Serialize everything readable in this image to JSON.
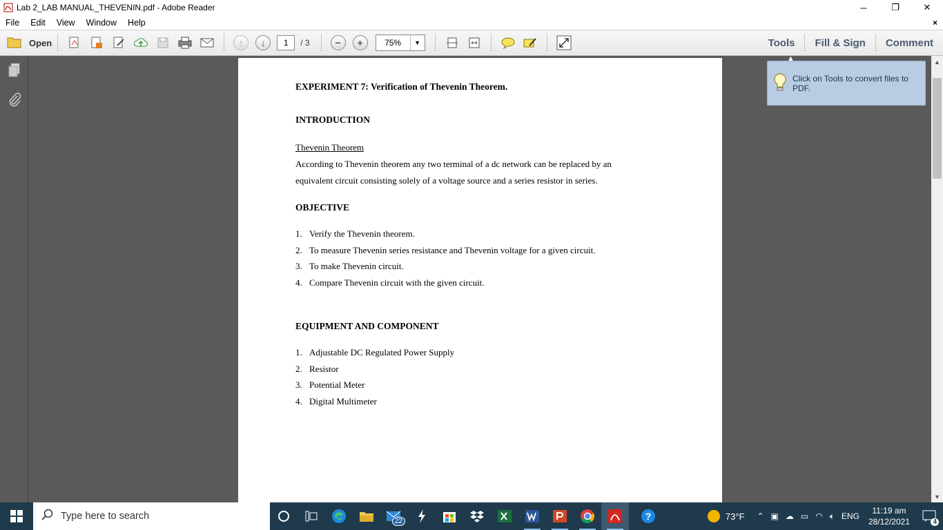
{
  "window": {
    "title": "Lab 2_LAB MANUAL_THEVENIN.pdf - Adobe Reader",
    "minimize": "─",
    "restore": "❐",
    "close": "✕"
  },
  "menu": {
    "items": [
      "File",
      "Edit",
      "View",
      "Window",
      "Help"
    ],
    "close_doc": "×"
  },
  "toolbar": {
    "open_label": "Open",
    "page_current": "1",
    "page_total": "/ 3",
    "zoom_minus": "−",
    "zoom_plus": "+",
    "zoom_value": "75%",
    "links": [
      "Tools",
      "Fill & Sign",
      "Comment"
    ]
  },
  "tooltip": {
    "text": "Click on Tools to convert files to PDF."
  },
  "document": {
    "title": "EXPERIMENT 7: Verification of Thevenin Theorem.",
    "intro_heading": "INTRODUCTION",
    "theorem_heading": "Thevenin Theorem",
    "theorem_line1": "According to Thevenin theorem any two terminal of a dc network can be replaced by an",
    "theorem_line2": "equivalent circuit consisting solely of a voltage source and a series resistor in series.",
    "objective_heading": "OBJECTIVE",
    "objectives": [
      {
        "n": "1.",
        "text": "Verify the Thevenin theorem."
      },
      {
        "n": "2.",
        "text": "To measure Thevenin series resistance and Thevenin voltage for a given circuit."
      },
      {
        "n": "3.",
        "text": "To make Thevenin circuit."
      },
      {
        "n": "4.",
        "text": "Compare Thevenin circuit with the given circuit."
      }
    ],
    "equipment_heading": "EQUIPMENT AND COMPONENT",
    "equipment": [
      {
        "n": "1.",
        "text": "Adjustable DC Regulated Power Supply"
      },
      {
        "n": "2.",
        "text": "Resistor"
      },
      {
        "n": "3.",
        "text": "Potential Meter"
      },
      {
        "n": "4.",
        "text": "Digital Multimeter"
      }
    ]
  },
  "taskbar": {
    "search_placeholder": "Type here to search",
    "mail_badge": "22",
    "weather": "73°F",
    "language": "ENG",
    "time": "11:19 am",
    "date": "28/12/2021",
    "notification_count": "4"
  }
}
